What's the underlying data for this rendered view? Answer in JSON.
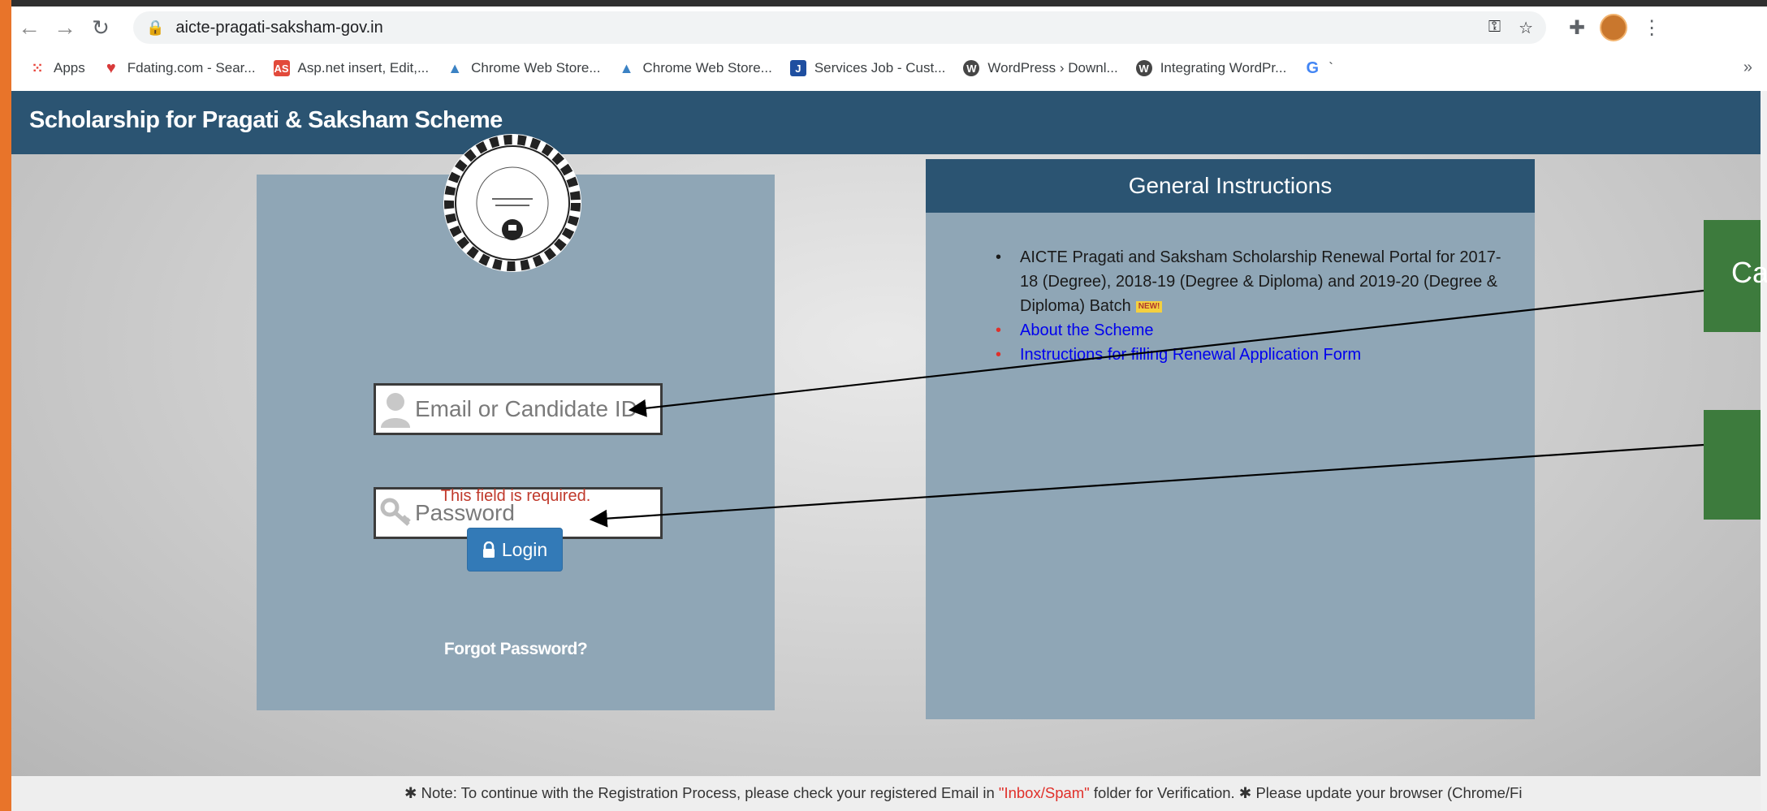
{
  "browser": {
    "url": "aicte-pragati-saksham-gov.in",
    "bookmarks": [
      {
        "label": "Apps",
        "icon": "apps-grid-icon",
        "color": "#e8453c"
      },
      {
        "label": "Fdating.com - Sear...",
        "icon": "heart-icon",
        "color": "#d83a3a"
      },
      {
        "label": "Asp.net insert, Edit,...",
        "icon": "asp-icon",
        "color": "#e24a3b"
      },
      {
        "label": "Chrome Web Store...",
        "icon": "chrome-webstore-icon",
        "color": "#3b82c4"
      },
      {
        "label": "Chrome Web Store...",
        "icon": "chrome-webstore-icon",
        "color": "#3b82c4"
      },
      {
        "label": "Services Job - Cust...",
        "icon": "j-icon",
        "color": "#1f4fa0"
      },
      {
        "label": "WordPress › Downl...",
        "icon": "wordpress-icon",
        "color": "#464646"
      },
      {
        "label": "Integrating WordPr...",
        "icon": "wordpress-icon",
        "color": "#464646"
      },
      {
        "label": "`",
        "icon": "google-icon",
        "color": "#4285f4"
      }
    ],
    "more_label": "»"
  },
  "header": {
    "title": "Scholarship for Pragati & Saksham Scheme"
  },
  "login": {
    "email_placeholder": "Email or Candidate ID",
    "password_placeholder": "Password",
    "error_text": "This field is required.",
    "login_label": "Login",
    "forgot_label": "Forgot Password?"
  },
  "instructions": {
    "title": "General Instructions",
    "item1": "AICTE Pragati and Saksham Scholarship Renewal Portal for 2017-18 (Degree), 2018-19 (Degree & Diploma) and 2019-20 (Degree & Diploma) Batch",
    "new_badge": "NEW!",
    "item2": "About the Scheme",
    "item3": "Instructions for filling Renewal Application Form"
  },
  "callouts": {
    "c1": "Ca"
  },
  "note": {
    "prefix": "✱ Note: To continue with the Registration Process, please check your registered Email in ",
    "highlight": "\"Inbox/Spam\"",
    "suffix": " folder for Verification. ✱ Please update your browser (Chrome/Fi"
  }
}
